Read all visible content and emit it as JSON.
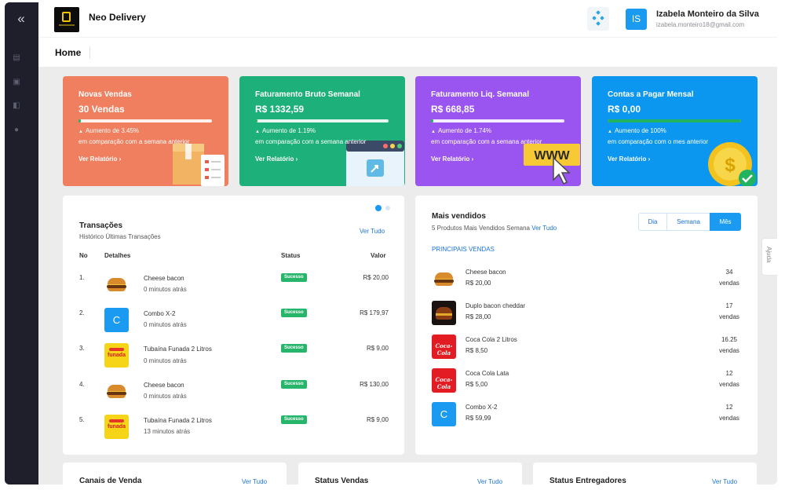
{
  "app": {
    "brand": "Neo Delivery"
  },
  "user": {
    "initials": "IS",
    "name": "Izabela Monteiro da Silva",
    "email": "izabela.monteiro18@gmail.com"
  },
  "page": {
    "title": "Home",
    "help": "Ajuda"
  },
  "stats": [
    {
      "title": "Novas Vendas",
      "value": "30 Vendas",
      "progress": 0.02,
      "change": "Aumento de 3.45%",
      "compare": "em comparação com a semana anterior",
      "report": "Ver Relatório",
      "color": "#ef7f5f"
    },
    {
      "title": "Faturamento Bruto Semanal",
      "value": "R$ 1332,59",
      "progress": 0.02,
      "change": "Aumento de 1.19%",
      "compare": "em comparação com a semana anterior",
      "report": "Ver Relatório",
      "color": "#1eb07a"
    },
    {
      "title": "Faturamento Liq. Semanal",
      "value": "R$ 668,85",
      "progress": 0.02,
      "change": "Aumento de 1.74%",
      "compare": "em comparação com a semana anterior",
      "report": "Ver Relatório",
      "color": "#9a55f0",
      "www": "WWW"
    },
    {
      "title": "Contas a Pagar Mensal",
      "value": "R$ 0,00",
      "progress": 1.0,
      "change": "Aumento de 100%",
      "compare": "em comparação com o mes anterior",
      "report": "Ver Relatório",
      "color": "#0b96f0"
    }
  ],
  "transactions": {
    "title": "Transações",
    "subtitle": "Histórico Últimas Transações",
    "see_all": "Ver Tudo",
    "headers": {
      "no": "No",
      "details": "Detalhes",
      "status": "Status",
      "value": "Valor"
    },
    "rows": [
      {
        "no": "1.",
        "name": "Cheese bacon",
        "time": "0 minutos atrás",
        "status": "Sucesso",
        "amount": "R$ 20,00",
        "thumb": "burger"
      },
      {
        "no": "2.",
        "name": "Combo X-2",
        "time": "0 minutos atrás",
        "status": "Sucesso",
        "amount": "R$ 179,97",
        "thumb": "combo",
        "letter": "C"
      },
      {
        "no": "3.",
        "name": "Tubaína Funada 2 Litros",
        "time": "0 minutos atrás",
        "status": "Sucesso",
        "amount": "R$ 9,00",
        "thumb": "funada",
        "brand": "funada"
      },
      {
        "no": "4.",
        "name": "Cheese bacon",
        "time": "0 minutos atrás",
        "status": "Sucesso",
        "amount": "R$ 130,00",
        "thumb": "burger"
      },
      {
        "no": "5.",
        "name": "Tubaína Funada 2 Litros",
        "time": "13 minutos atrás",
        "status": "Sucesso",
        "amount": "R$ 9,00",
        "thumb": "funada",
        "brand": "funada"
      }
    ]
  },
  "best_sellers": {
    "title": "Mais vendidos",
    "subtitle": "5 Produtos Mais Vendidos Semana",
    "see_all": "Ver Tudo",
    "section": "PRINCIPAIS VENDAS",
    "tabs": [
      "Dia",
      "Semana",
      "Mês"
    ],
    "active_tab": "Mês",
    "unit": "vendas",
    "items": [
      {
        "name": "Cheese bacon",
        "price": "R$ 20,00",
        "qty": "34",
        "thumb": "burger"
      },
      {
        "name": "Duplo bacon cheddar",
        "price": "R$ 28,00",
        "qty": "17",
        "thumb": "dark"
      },
      {
        "name": "Coca Cola 2 Litros",
        "price": "R$ 8,50",
        "qty": "16.25",
        "thumb": "coke",
        "brand": "Coca-Cola"
      },
      {
        "name": "Coca Cola Lata",
        "price": "R$ 5,00",
        "qty": "12",
        "thumb": "coke",
        "brand": "Coca-Cola"
      },
      {
        "name": "Combo X-2",
        "price": "R$ 59,99",
        "qty": "12",
        "thumb": "combo",
        "letter": "C"
      }
    ]
  },
  "bottom_cards": [
    {
      "title": "Canais de Venda",
      "see_all": "Ver Tudo"
    },
    {
      "title": "Status Vendas",
      "see_all": "Ver Tudo"
    },
    {
      "title": "Status Entregadores",
      "see_all": "Ver Tudo"
    }
  ]
}
